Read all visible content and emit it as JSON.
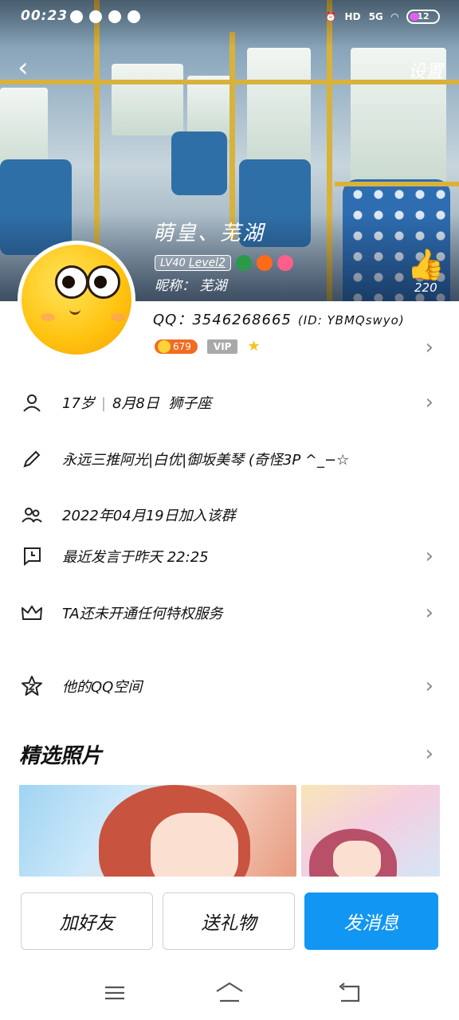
{
  "status_bar": {
    "time": "00:23",
    "network": "5G",
    "hd": "HD",
    "battery": "12"
  },
  "header": {
    "back_icon": "chevron-left",
    "settings_label": "设置"
  },
  "profile": {
    "nickname": "萌皇、芜湖",
    "level_prefix": "LV40",
    "level_label": "Level2",
    "alias_label": "昵称：",
    "alias": "芜湖",
    "likes": "220",
    "qq_label": "QQ：",
    "qq_number": "3546268665",
    "qq_id": "(ID: YBMQswyo)",
    "coin_count": "679",
    "vip_label": "VIP"
  },
  "rows": {
    "age": "17岁",
    "birthday": "8月8日",
    "zodiac": "狮子座",
    "signature": "永远三推阿光|白优|御坂美琴 (奇怪3P ^_−☆",
    "joined": "2022年04月19日加入该群",
    "last_speak": "最近发言于昨天 22:25",
    "privilege": "TA还未开通任何特权服务",
    "qzone": "他的QQ空间"
  },
  "photos": {
    "title": "精选照片"
  },
  "actions": {
    "add_friend": "加好友",
    "send_gift": "送礼物",
    "send_message": "发消息"
  },
  "colors": {
    "accent": "#1296f3",
    "coin": "#f26b22",
    "vip": "#a9a9a9"
  }
}
